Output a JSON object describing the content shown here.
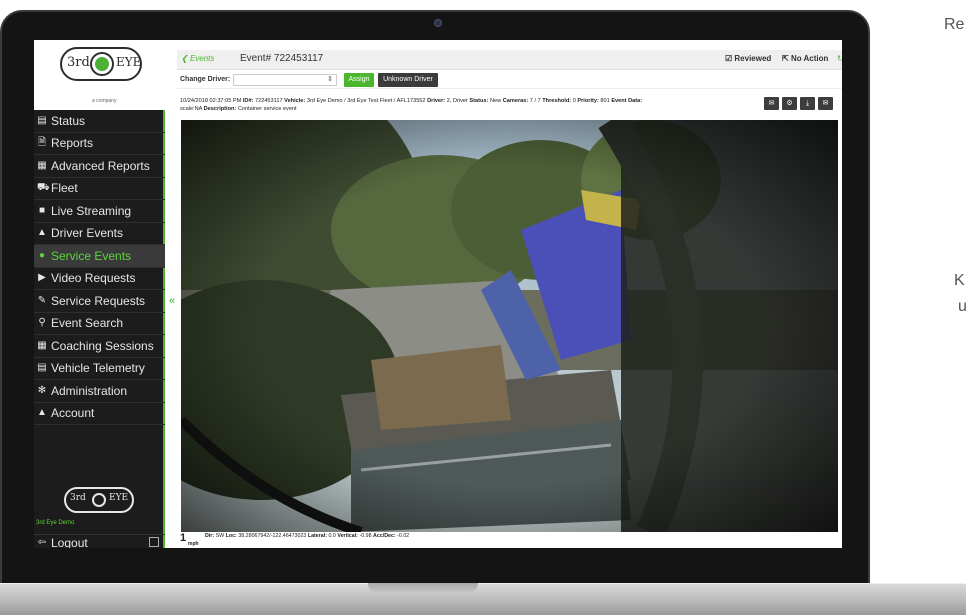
{
  "right_page": {
    "frag_top": "Re",
    "frag_mid": "K",
    "frag_low": "u"
  },
  "sidebar": {
    "brand_text_left": "3rd",
    "brand_text_right": "EYE",
    "brand_subtext": "a company",
    "items": [
      {
        "label": "Status",
        "icon": "status-icon",
        "glyph": "▤"
      },
      {
        "label": "Reports",
        "icon": "document-icon",
        "glyph": "🗎"
      },
      {
        "label": "Advanced Reports",
        "icon": "bar-chart-icon",
        "glyph": "▦"
      },
      {
        "label": "Fleet",
        "icon": "truck-icon",
        "glyph": "⛟"
      },
      {
        "label": "Live Streaming",
        "icon": "video-camera-icon",
        "glyph": "■"
      },
      {
        "label": "Driver Events",
        "icon": "warning-icon",
        "glyph": "▲"
      },
      {
        "label": "Service Events",
        "icon": "info-icon",
        "glyph": "●",
        "active": true
      },
      {
        "label": "Video Requests",
        "icon": "play-icon",
        "glyph": "▶"
      },
      {
        "label": "Service Requests",
        "icon": "wrench-icon",
        "glyph": "✎"
      },
      {
        "label": "Event Search",
        "icon": "search-icon",
        "glyph": "⚲"
      },
      {
        "label": "Coaching Sessions",
        "icon": "calendar-icon",
        "glyph": "▦"
      },
      {
        "label": "Vehicle Telemetry",
        "icon": "list-icon",
        "glyph": "▤"
      },
      {
        "label": "Administration",
        "icon": "gear-icon",
        "glyph": "✻"
      },
      {
        "label": "Account",
        "icon": "user-icon",
        "glyph": "▲"
      }
    ],
    "org_name": "3rd Eye Demo",
    "logout_label": "Logout",
    "collapse_glyph": "«"
  },
  "topbar": {
    "back_label": "Events",
    "event_title": "Event# 722453117",
    "reviewed_label": "Reviewed",
    "no_action_label": "No Action"
  },
  "driverbar": {
    "label": "Change Driver:",
    "select_value": "",
    "assign_label": "Assign",
    "unknown_label": "Unknown Driver"
  },
  "details": {
    "datetime": "10/24/2018 02:37:05 PM",
    "id_label": "ID#:",
    "id_value": "722453117",
    "vehicle_label": "Vehicle:",
    "vehicle_value": "3rd Eye Demo / 3rd Eye Test Fleet / AFL173552",
    "driver_label": "Driver:",
    "driver_value": "2, Driver",
    "status_label": "Status:",
    "status_value": "New",
    "cameras_label": "Cameras:",
    "cameras_value": "7 / 7",
    "threshold_label": "Threshold:",
    "threshold_value": "0",
    "priority_label": "Priority:",
    "priority_value": "801",
    "eventdata_label": "Event Data:",
    "eventdata_value": "scale:NA",
    "description_label": "Description:",
    "description_value": "Container service event"
  },
  "actions": [
    "comment-icon",
    "gear-icon",
    "download-icon",
    "email-icon"
  ],
  "telemetry": {
    "speed": "1",
    "unit": "mph",
    "dir_label": "Dir:",
    "dir_value": "SW",
    "loc_label": "Loc:",
    "loc_value": "38.28067942/-122.46473023",
    "lateral_label": "Lateral:",
    "lateral_value": "0.0",
    "vertical_label": "Vertical:",
    "vertical_value": "-0.98",
    "accdec_label": "Acc/Dec:",
    "accdec_value": "-0.02"
  },
  "colors": {
    "accent": "#49b62e",
    "sidebar_bg": "#1c1c1c",
    "active_text": "#5dd33c"
  }
}
